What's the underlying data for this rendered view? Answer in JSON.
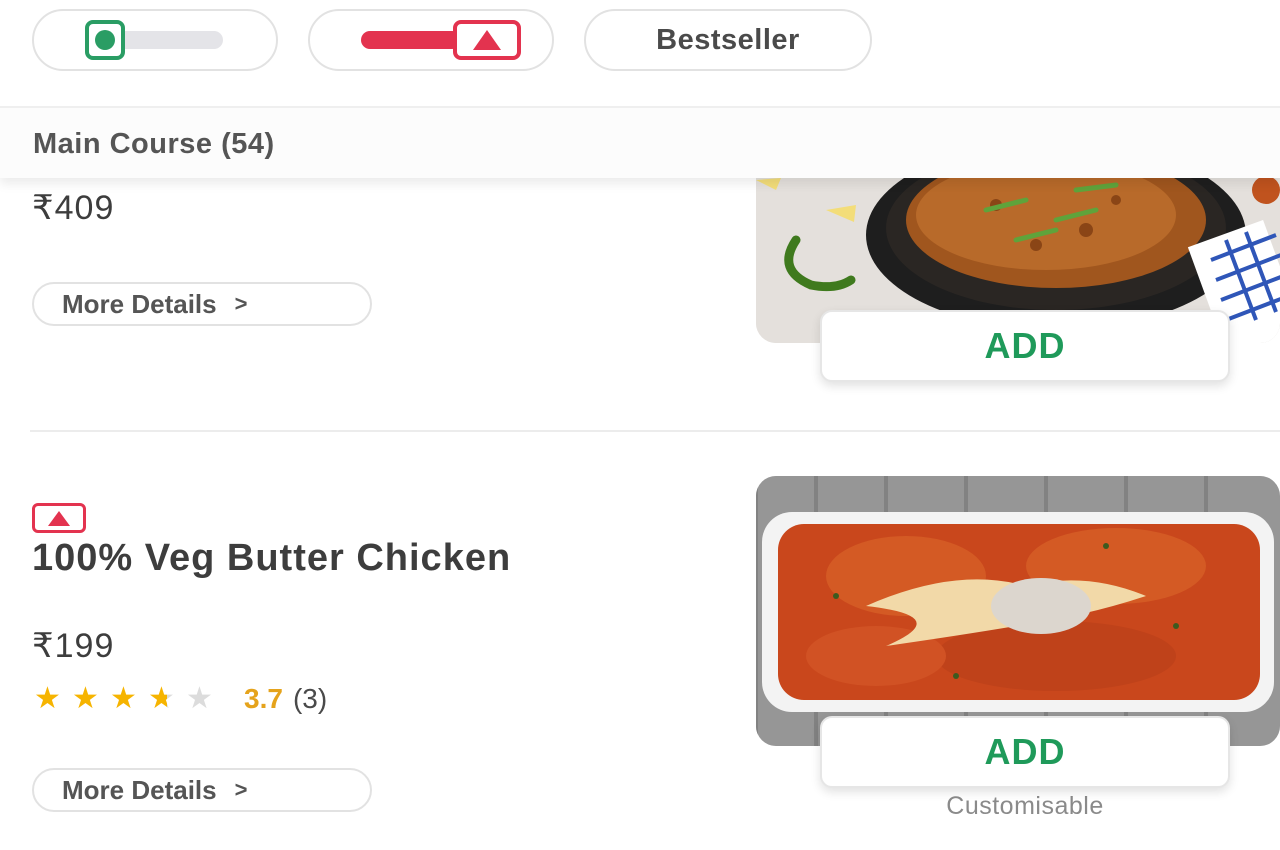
{
  "filters": {
    "veg_toggle": {
      "icon": "veg-indicator-icon",
      "color": "#2a9d64",
      "on": true
    },
    "nonveg_toggle": {
      "icon": "nonveg-indicator-icon",
      "color": "#e3334f",
      "on": true
    },
    "bestseller_label": "Bestseller"
  },
  "category": {
    "title": "Main Course (54)"
  },
  "items": [
    {
      "price": "₹409",
      "more_details_label": "More Details",
      "add_label": "ADD"
    },
    {
      "type_icon": "nonveg-indicator-icon",
      "name": "100% Veg Butter Chicken",
      "price": "₹199",
      "rating": {
        "value": "3.7",
        "count": "(3)",
        "stars": 3.5,
        "max": 5
      },
      "more_details_label": "More Details",
      "add_label": "ADD",
      "customisable_label": "Customisable"
    }
  ],
  "colors": {
    "accent_green": "#1f9a5a",
    "veg_green": "#2a9d64",
    "nonveg_red": "#e3334f",
    "star_gold": "#f6b400",
    "rating_text": "#e5a31c"
  }
}
